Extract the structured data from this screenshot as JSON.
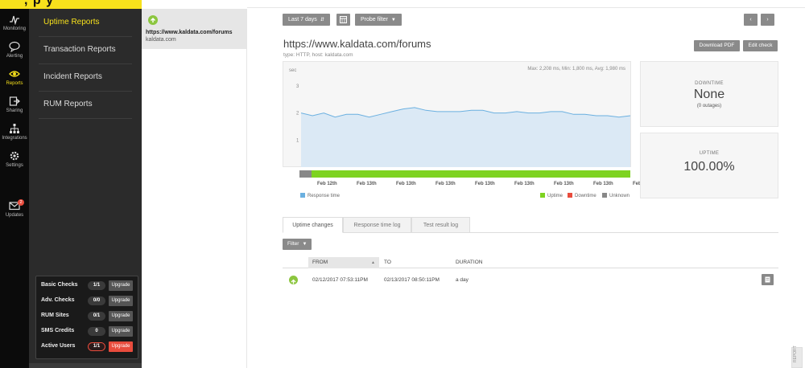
{
  "brand": {
    "logo": ", p y"
  },
  "rail": {
    "items": [
      {
        "label": "Monitoring",
        "icon": "pulse-icon",
        "active": false
      },
      {
        "label": "Alerting",
        "icon": "speech-bubble-icon",
        "active": false
      },
      {
        "label": "Reports",
        "icon": "eye-icon",
        "active": true
      },
      {
        "label": "Sharing",
        "icon": "share-icon",
        "active": false
      },
      {
        "label": "Integrations",
        "icon": "hierarchy-icon",
        "active": false
      },
      {
        "label": "Settings",
        "icon": "gear-icon",
        "active": false
      },
      {
        "label": "Updates",
        "icon": "envelope-icon",
        "active": false,
        "badge": "2"
      }
    ]
  },
  "nav2": {
    "items": [
      {
        "label": "Uptime Reports",
        "active": true
      },
      {
        "label": "Transaction Reports",
        "active": false
      },
      {
        "label": "Incident Reports",
        "active": false
      },
      {
        "label": "RUM Reports",
        "active": false
      }
    ]
  },
  "quota": {
    "rows": [
      {
        "name": "Basic Checks",
        "value": "1/1",
        "button": "Upgrade",
        "warn": false
      },
      {
        "name": "Adv. Checks",
        "value": "0/0",
        "button": "Upgrade",
        "warn": false
      },
      {
        "name": "RUM Sites",
        "value": "0/1",
        "button": "Upgrade",
        "warn": false
      },
      {
        "name": "SMS Credits",
        "value": "0",
        "button": "Upgrade",
        "warn": false
      },
      {
        "name": "Active Users",
        "value": "1/1",
        "button": "Upgrade",
        "warn": true
      }
    ]
  },
  "checklist": {
    "items": [
      {
        "url": "https://www.kaldata.com/forums",
        "host": "kaldata.com",
        "status_icon": "arrow-up-icon"
      }
    ]
  },
  "toolbar": {
    "range": "Last 7 days",
    "calendar_icon": "calendar-icon",
    "probe": "Probe filter",
    "prev_icon": "chevron-left-icon",
    "next_icon": "chevron-right-icon"
  },
  "check": {
    "title": "https://www.kaldata.com/forums",
    "subtitle": "type: HTTP, host: kaldata.com",
    "download_label": "Download PDF",
    "edit_label": "Edit check"
  },
  "chart_data": {
    "type": "area",
    "ylabel": "sec",
    "yticks": [
      1,
      2,
      3
    ],
    "ylim": [
      0,
      3.8
    ],
    "stats": "Max: 2,208 ms, Min: 1,800 ms, Avg: 1,980 ms",
    "series": [
      {
        "name": "Response time",
        "values": [
          2.0,
          1.9,
          2.0,
          1.85,
          1.95,
          1.95,
          1.85,
          1.95,
          2.05,
          2.15,
          2.2,
          2.1,
          2.05,
          2.05,
          2.05,
          2.1,
          2.1,
          2.0,
          2.0,
          2.05,
          2.0,
          2.0,
          2.05,
          2.05,
          1.95,
          1.95,
          1.9,
          1.9,
          1.85,
          1.9
        ]
      }
    ],
    "xticks": [
      "Feb 12th",
      "Feb 13th",
      "Feb 13th",
      "Feb 13th",
      "Feb 13th",
      "Feb 13th",
      "Feb 13th",
      "Feb 13th",
      "Feb 13th"
    ],
    "legend": {
      "response": "Response time",
      "uptime": "Uptime",
      "downtime": "Downtime",
      "unknown": "Unknown"
    },
    "status_unknown_fraction": 0.036,
    "colors": {
      "line": "#6bb0e0",
      "fill": "#dbe9f5",
      "uptime": "#7ed321",
      "downtime": "#e84c3d",
      "unknown": "#888888"
    }
  },
  "downtime": {
    "label": "DOWNTIME",
    "value": "None",
    "sub": "(0 outages)"
  },
  "uptime": {
    "label": "UPTIME",
    "value": "100.00%"
  },
  "tabs": [
    {
      "label": "Uptime changes",
      "active": true
    },
    {
      "label": "Response time log",
      "active": false
    },
    {
      "label": "Test result log",
      "active": false
    }
  ],
  "filter": {
    "label": "Filter"
  },
  "table": {
    "headers": {
      "from": "FROM",
      "to": "TO",
      "duration": "DURATION"
    },
    "rows": [
      {
        "from": "02/12/2017 07:53:11PM",
        "to": "02/13/2017 08:50:11PM",
        "duration": "a day",
        "status_icon": "arrow-up-icon",
        "note_icon": "note-icon"
      }
    ]
  },
  "report_tab": {
    "label": "REPORT"
  }
}
